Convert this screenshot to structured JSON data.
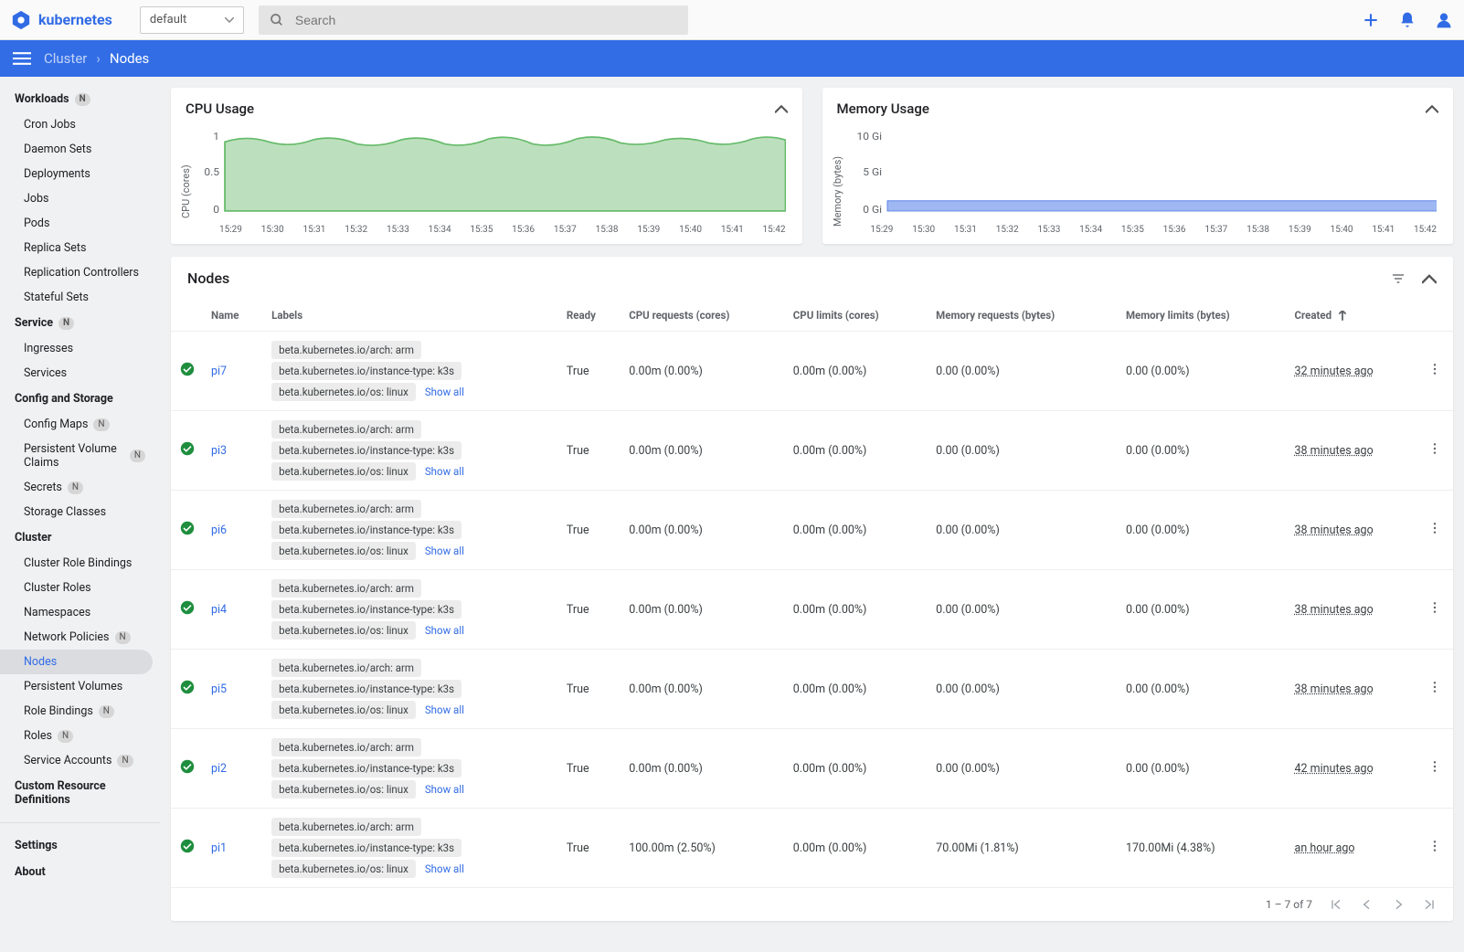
{
  "brand": "kubernetes",
  "namespace": "default",
  "search_placeholder": "Search",
  "breadcrumb": {
    "parent": "Cluster",
    "current": "Nodes"
  },
  "sidebar": {
    "sections": [
      {
        "title": "Workloads",
        "badge": "N",
        "items": [
          {
            "label": "Cron Jobs"
          },
          {
            "label": "Daemon Sets"
          },
          {
            "label": "Deployments"
          },
          {
            "label": "Jobs"
          },
          {
            "label": "Pods"
          },
          {
            "label": "Replica Sets"
          },
          {
            "label": "Replication Controllers"
          },
          {
            "label": "Stateful Sets"
          }
        ]
      },
      {
        "title": "Service",
        "badge": "N",
        "items": [
          {
            "label": "Ingresses"
          },
          {
            "label": "Services"
          }
        ]
      },
      {
        "title": "Config and Storage",
        "items": [
          {
            "label": "Config Maps",
            "badge": "N"
          },
          {
            "label": "Persistent Volume Claims",
            "badge": "N"
          },
          {
            "label": "Secrets",
            "badge": "N"
          },
          {
            "label": "Storage Classes"
          }
        ]
      },
      {
        "title": "Cluster",
        "items": [
          {
            "label": "Cluster Role Bindings"
          },
          {
            "label": "Cluster Roles"
          },
          {
            "label": "Namespaces"
          },
          {
            "label": "Network Policies",
            "badge": "N"
          },
          {
            "label": "Nodes",
            "active": true
          },
          {
            "label": "Persistent Volumes"
          },
          {
            "label": "Role Bindings",
            "badge": "N"
          },
          {
            "label": "Roles",
            "badge": "N"
          },
          {
            "label": "Service Accounts",
            "badge": "N"
          }
        ]
      },
      {
        "title": "Custom Resource Definitions",
        "items": []
      }
    ],
    "footer": [
      {
        "label": "Settings"
      },
      {
        "label": "About"
      }
    ]
  },
  "charts": {
    "cpu": {
      "title": "CPU Usage",
      "ylabel": "CPU (cores)",
      "yticks": [
        "1",
        "0.5",
        "0"
      ]
    },
    "memory": {
      "title": "Memory Usage",
      "ylabel": "Memory (bytes)",
      "yticks": [
        "10 Gi",
        "5 Gi",
        "0 Gi"
      ]
    },
    "xticks": [
      "15:29",
      "15:30",
      "15:31",
      "15:32",
      "15:33",
      "15:34",
      "15:35",
      "15:36",
      "15:37",
      "15:38",
      "15:39",
      "15:40",
      "15:41",
      "15:42"
    ]
  },
  "chart_data": [
    {
      "type": "area",
      "title": "CPU Usage",
      "ylabel": "CPU (cores)",
      "ylim": [
        0,
        1.2
      ],
      "x": [
        "15:29",
        "15:30",
        "15:31",
        "15:32",
        "15:33",
        "15:34",
        "15:35",
        "15:36",
        "15:37",
        "15:38",
        "15:39",
        "15:40",
        "15:41",
        "15:42"
      ],
      "series": [
        {
          "name": "CPU",
          "values": [
            0.95,
            1.0,
            0.9,
            1.0,
            0.9,
            1.0,
            0.9,
            1.0,
            0.92,
            1.0,
            0.93,
            0.98,
            0.92,
            1.0
          ]
        }
      ]
    },
    {
      "type": "area",
      "title": "Memory Usage",
      "ylabel": "Memory (bytes)",
      "ylim": [
        0,
        12
      ],
      "unit": "Gi",
      "x": [
        "15:29",
        "15:30",
        "15:31",
        "15:32",
        "15:33",
        "15:34",
        "15:35",
        "15:36",
        "15:37",
        "15:38",
        "15:39",
        "15:40",
        "15:41",
        "15:42"
      ],
      "series": [
        {
          "name": "Memory",
          "values": [
            1,
            1,
            1,
            1,
            1,
            1,
            1,
            1,
            1,
            1,
            1,
            1,
            1,
            1
          ]
        }
      ]
    }
  ],
  "nodes_panel": {
    "title": "Nodes",
    "columns": [
      "Name",
      "Labels",
      "Ready",
      "CPU requests (cores)",
      "CPU limits (cores)",
      "Memory requests (bytes)",
      "Memory limits (bytes)",
      "Created"
    ],
    "show_all": "Show all",
    "rows": [
      {
        "name": "pi7",
        "labels": [
          "beta.kubernetes.io/arch: arm",
          "beta.kubernetes.io/instance-type: k3s",
          "beta.kubernetes.io/os: linux"
        ],
        "ready": "True",
        "cpu_req": "0.00m (0.00%)",
        "cpu_lim": "0.00m (0.00%)",
        "mem_req": "0.00 (0.00%)",
        "mem_lim": "0.00 (0.00%)",
        "created": "32 minutes ago"
      },
      {
        "name": "pi3",
        "labels": [
          "beta.kubernetes.io/arch: arm",
          "beta.kubernetes.io/instance-type: k3s",
          "beta.kubernetes.io/os: linux"
        ],
        "ready": "True",
        "cpu_req": "0.00m (0.00%)",
        "cpu_lim": "0.00m (0.00%)",
        "mem_req": "0.00 (0.00%)",
        "mem_lim": "0.00 (0.00%)",
        "created": "38 minutes ago"
      },
      {
        "name": "pi6",
        "labels": [
          "beta.kubernetes.io/arch: arm",
          "beta.kubernetes.io/instance-type: k3s",
          "beta.kubernetes.io/os: linux"
        ],
        "ready": "True",
        "cpu_req": "0.00m (0.00%)",
        "cpu_lim": "0.00m (0.00%)",
        "mem_req": "0.00 (0.00%)",
        "mem_lim": "0.00 (0.00%)",
        "created": "38 minutes ago"
      },
      {
        "name": "pi4",
        "labels": [
          "beta.kubernetes.io/arch: arm",
          "beta.kubernetes.io/instance-type: k3s",
          "beta.kubernetes.io/os: linux"
        ],
        "ready": "True",
        "cpu_req": "0.00m (0.00%)",
        "cpu_lim": "0.00m (0.00%)",
        "mem_req": "0.00 (0.00%)",
        "mem_lim": "0.00 (0.00%)",
        "created": "38 minutes ago"
      },
      {
        "name": "pi5",
        "labels": [
          "beta.kubernetes.io/arch: arm",
          "beta.kubernetes.io/instance-type: k3s",
          "beta.kubernetes.io/os: linux"
        ],
        "ready": "True",
        "cpu_req": "0.00m (0.00%)",
        "cpu_lim": "0.00m (0.00%)",
        "mem_req": "0.00 (0.00%)",
        "mem_lim": "0.00 (0.00%)",
        "created": "38 minutes ago"
      },
      {
        "name": "pi2",
        "labels": [
          "beta.kubernetes.io/arch: arm",
          "beta.kubernetes.io/instance-type: k3s",
          "beta.kubernetes.io/os: linux"
        ],
        "ready": "True",
        "cpu_req": "0.00m (0.00%)",
        "cpu_lim": "0.00m (0.00%)",
        "mem_req": "0.00 (0.00%)",
        "mem_lim": "0.00 (0.00%)",
        "created": "42 minutes ago"
      },
      {
        "name": "pi1",
        "labels": [
          "beta.kubernetes.io/arch: arm",
          "beta.kubernetes.io/instance-type: k3s",
          "beta.kubernetes.io/os: linux"
        ],
        "ready": "True",
        "cpu_req": "100.00m (2.50%)",
        "cpu_lim": "0.00m (0.00%)",
        "mem_req": "70.00Mi (1.81%)",
        "mem_lim": "170.00Mi (4.38%)",
        "created": "an hour ago"
      }
    ],
    "pagination": "1 – 7 of 7"
  }
}
